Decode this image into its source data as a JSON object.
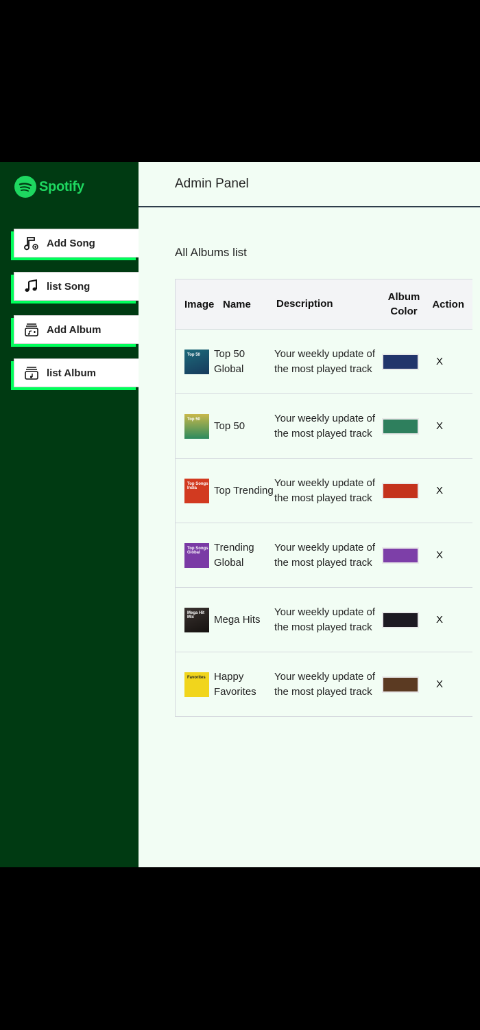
{
  "brand": {
    "name": "Spotify",
    "color": "#1ed760"
  },
  "sidebar": {
    "items": [
      {
        "label": "Add Song",
        "icon": "add-music-icon"
      },
      {
        "label": "list Song",
        "icon": "music-note-icon"
      },
      {
        "label": "Add Album",
        "icon": "add-album-icon"
      },
      {
        "label": "list Album",
        "icon": "album-list-icon"
      }
    ]
  },
  "header": {
    "title": "Admin Panel"
  },
  "main": {
    "section_title": "All Albums list",
    "columns": {
      "image": "Image",
      "name": "Name",
      "description": "Description",
      "album_color": "Album Color",
      "action": "Action"
    },
    "rows": [
      {
        "name": "Top 50 Global",
        "description": "Your weekly update of the most played track",
        "color": "#22346b",
        "action": "X",
        "thumb_text": "Top 50",
        "thumb_bg": "linear-gradient(160deg,#1c6a7a,#173a5c)"
      },
      {
        "name": "Top 50",
        "description": "Your weekly update of the most played track",
        "color": "#2e7f5d",
        "action": "X",
        "thumb_text": "Top 50",
        "thumb_bg": "linear-gradient(180deg,#c8b84a,#2d8a5e)"
      },
      {
        "name": "Top Trending",
        "description": "Your weekly update of the most played track",
        "color": "#c4321c",
        "action": "X",
        "thumb_text": "Top Songs India",
        "thumb_bg": "#d23a20"
      },
      {
        "name": "Trending Global",
        "description": "Your weekly update of the most played track",
        "color": "#7d3fa8",
        "action": "X",
        "thumb_text": "Top Songs Global",
        "thumb_bg": "#7a3aa5"
      },
      {
        "name": "Mega Hits",
        "description": "Your weekly update of the most played track",
        "color": "#1d1a22",
        "action": "X",
        "thumb_text": "Mega Hit Mix",
        "thumb_bg": "linear-gradient(160deg,#3a3330,#15110f)"
      },
      {
        "name": "Happy Favorites",
        "description": "Your weekly update of the most played track",
        "color": "#5b3a22",
        "action": "X",
        "thumb_text": "Favorites",
        "thumb_bg": "#f1d51c"
      }
    ]
  }
}
